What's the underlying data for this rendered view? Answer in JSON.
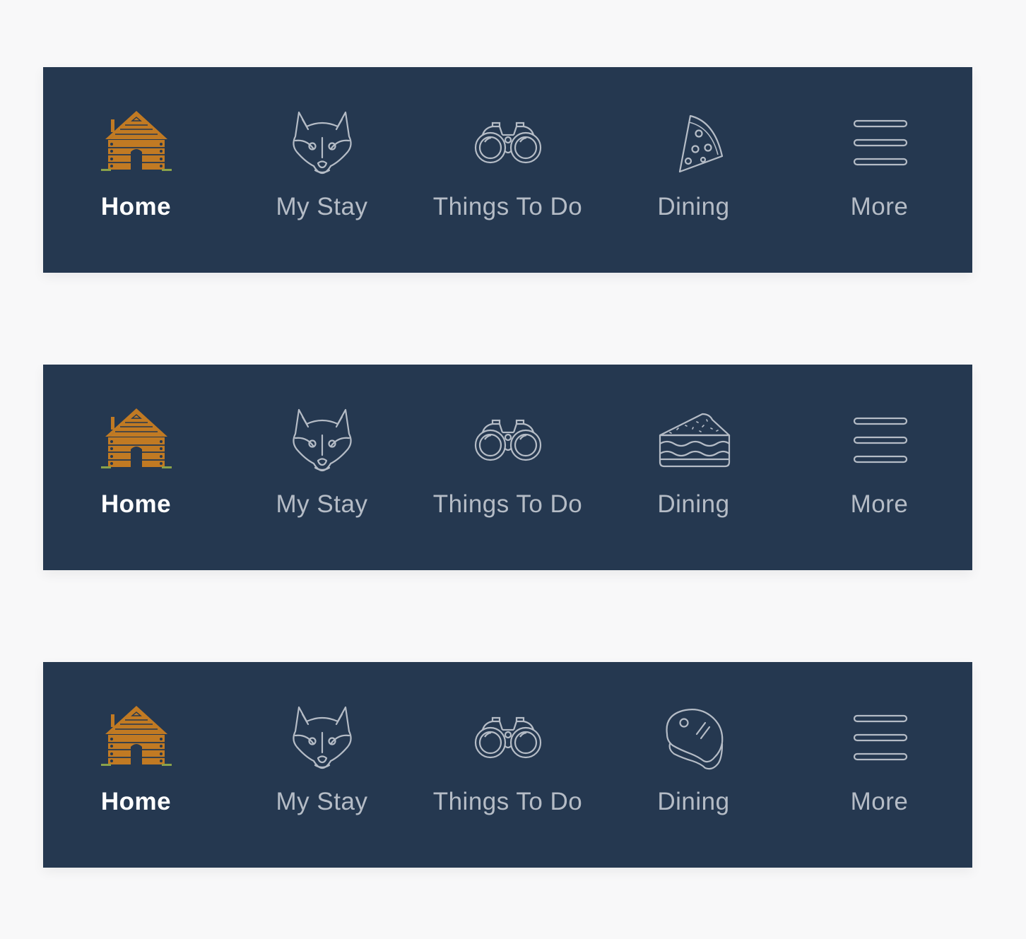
{
  "colors": {
    "page_background": "#f8f8f9",
    "bar_background": "#253850",
    "active_label": "#ffffff",
    "inactive_label": "#b5bcc6",
    "cabin_accent": "#c17a23",
    "grass_accent": "#8aa24a",
    "icon_stroke": "#b5bcc6"
  },
  "bars": [
    {
      "variant": "pizza",
      "tabs": [
        {
          "label": "Home",
          "icon": "cabin-icon",
          "active": true
        },
        {
          "label": "My Stay",
          "icon": "fox-icon",
          "active": false
        },
        {
          "label": "Things To Do",
          "icon": "binoculars-icon",
          "active": false
        },
        {
          "label": "Dining",
          "icon": "pizza-slice-icon",
          "active": false
        },
        {
          "label": "More",
          "icon": "menu-icon",
          "active": false
        }
      ]
    },
    {
      "variant": "sandwich",
      "tabs": [
        {
          "label": "Home",
          "icon": "cabin-icon",
          "active": true
        },
        {
          "label": "My Stay",
          "icon": "fox-icon",
          "active": false
        },
        {
          "label": "Things To Do",
          "icon": "binoculars-icon",
          "active": false
        },
        {
          "label": "Dining",
          "icon": "sandwich-icon",
          "active": false
        },
        {
          "label": "More",
          "icon": "menu-icon",
          "active": false
        }
      ]
    },
    {
      "variant": "steak",
      "tabs": [
        {
          "label": "Home",
          "icon": "cabin-icon",
          "active": true
        },
        {
          "label": "My Stay",
          "icon": "fox-icon",
          "active": false
        },
        {
          "label": "Things To Do",
          "icon": "binoculars-icon",
          "active": false
        },
        {
          "label": "Dining",
          "icon": "steak-icon",
          "active": false
        },
        {
          "label": "More",
          "icon": "menu-icon",
          "active": false
        }
      ]
    }
  ]
}
